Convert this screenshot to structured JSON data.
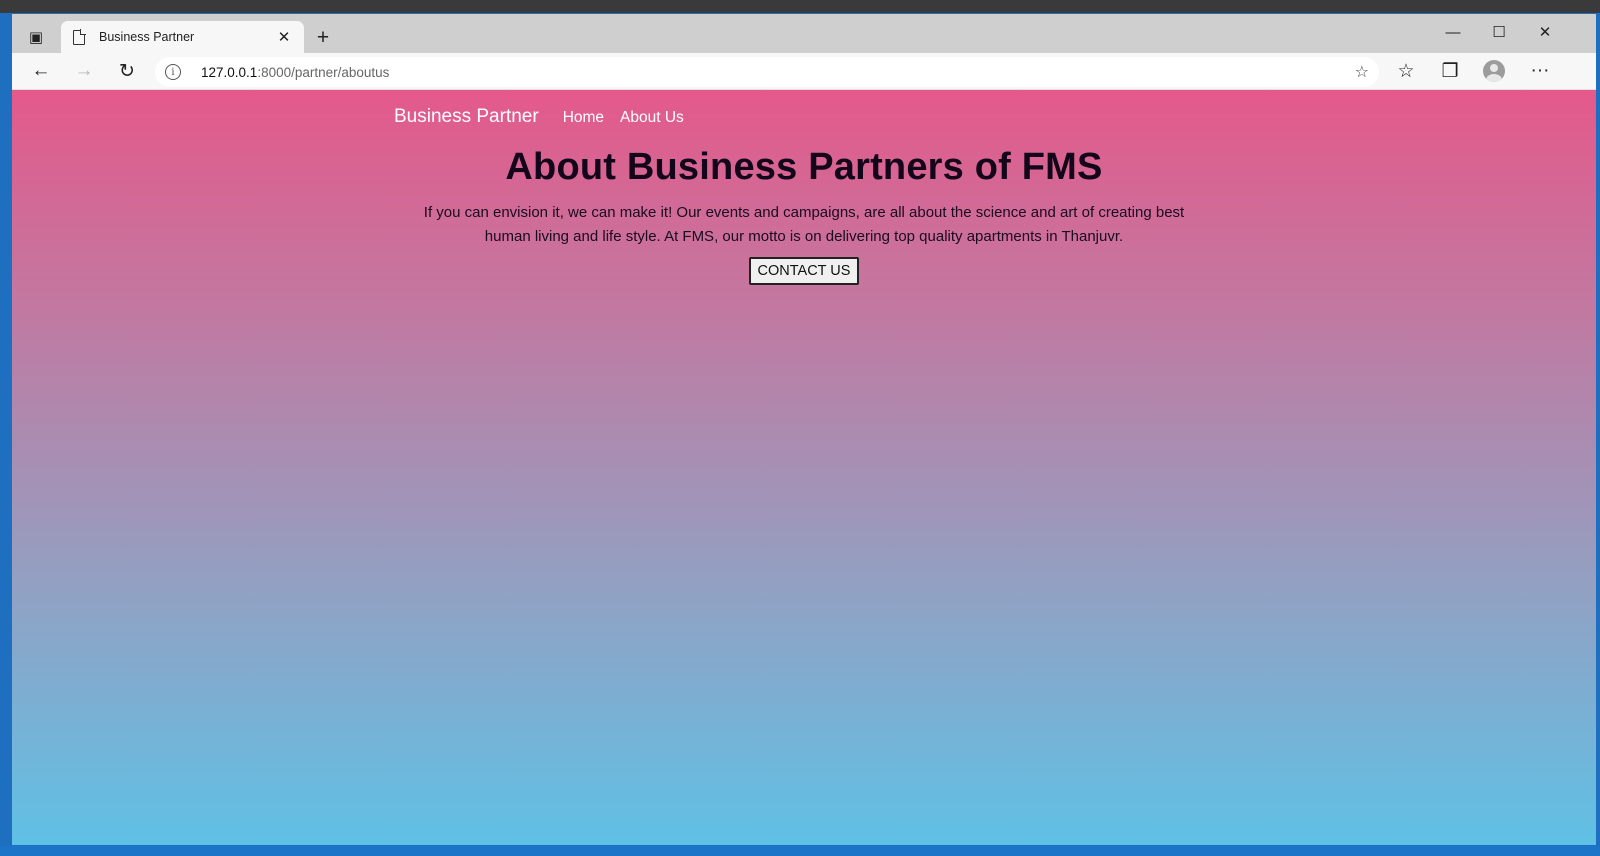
{
  "browser": {
    "tab_title": "Business Partner",
    "close_tab_glyph": "✕",
    "new_tab_glyph": "+",
    "url_host": "127.0.0.1",
    "url_path": ":8000/partner/aboutus",
    "window_controls": {
      "minimize": "—",
      "maximize": "☐",
      "close": "✕"
    },
    "toolbar_glyphs": {
      "back": "←",
      "forward": "→",
      "refresh": "↻",
      "favorites_add": "☆",
      "favorites": "☆",
      "collections": "❐",
      "more": "···"
    }
  },
  "nav": {
    "brand": "Business Partner",
    "links": [
      "Home",
      "About Us"
    ]
  },
  "hero": {
    "heading": "About Business Partners of FMS",
    "body": "If you can envision it, we can make it! Our events and campaigns, are all about the science and art of creating best human living and life style. At FMS, our motto is on delivering top quality apartments in Thanjuvr.",
    "button_label": "CONTACT US"
  },
  "colors": {
    "gradient_top": "#e4598a",
    "gradient_bottom": "#5fc1e6"
  }
}
